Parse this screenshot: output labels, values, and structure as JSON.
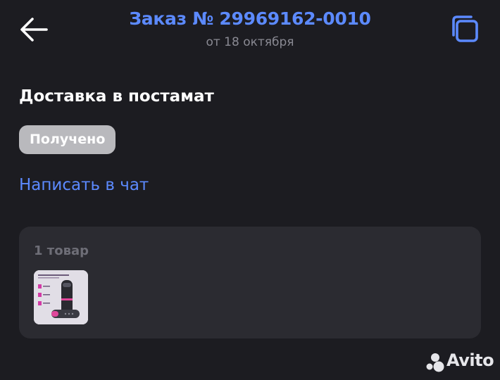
{
  "header": {
    "title": "Заказ № 29969162-0010",
    "subtitle": "от 18 октября",
    "back_icon": "arrow-left-icon",
    "copy_icon": "copy-icon"
  },
  "order": {
    "delivery_title": "Доставка в постамат",
    "status": "Получено",
    "chat_link": "Написать в чат"
  },
  "items": {
    "count_label": "1 товар",
    "products": [
      {
        "thumb_icon": "hair-curler-product-image"
      }
    ]
  },
  "watermark": {
    "brand": "Avito"
  },
  "colors": {
    "background": "#1c1c21",
    "accent": "#5c8aff",
    "card": "#2b2b31",
    "badge": "#b9b9bd",
    "muted": "#8a8a93"
  }
}
